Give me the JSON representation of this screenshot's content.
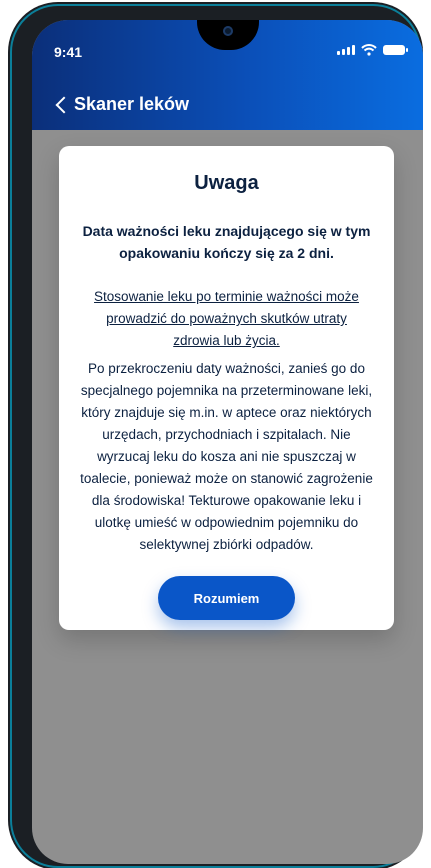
{
  "status": {
    "time": "9:41"
  },
  "header": {
    "title": "Skaner leków",
    "back_icon": "chevron-left-icon"
  },
  "modal": {
    "title": "Uwaga",
    "lead": "Data ważności leku znajdującego się w tym opakowaniu kończy się za 2 dni.",
    "warning": "Stosowanie leku po terminie ważności może prowadzić do poważnych skutków utraty zdrowia lub życia.",
    "body": "Po przekroczeniu daty ważności, zanieś go do specjalnego pojemnika na przeterminowane leki, który znajduje się m.in. w aptece oraz niektórych urzędach, przychodniach i szpitalach. Nie wyrzucaj leku do kosza ani nie spuszczaj w toalecie, ponieważ może on stanowić zagrożenie dla środowiska! Tekturowe opakowanie leku i ulotkę umieść w odpowiednim pojemniku do selektywnej zbiórki odpadów.",
    "button": "Rozumiem"
  },
  "colors": {
    "header_gradient_start": "#0b2f7a",
    "header_gradient_end": "#0a6de0",
    "overlay": "#8f8f8f",
    "button": "#0a56c8",
    "text_dark": "#0c2140"
  }
}
